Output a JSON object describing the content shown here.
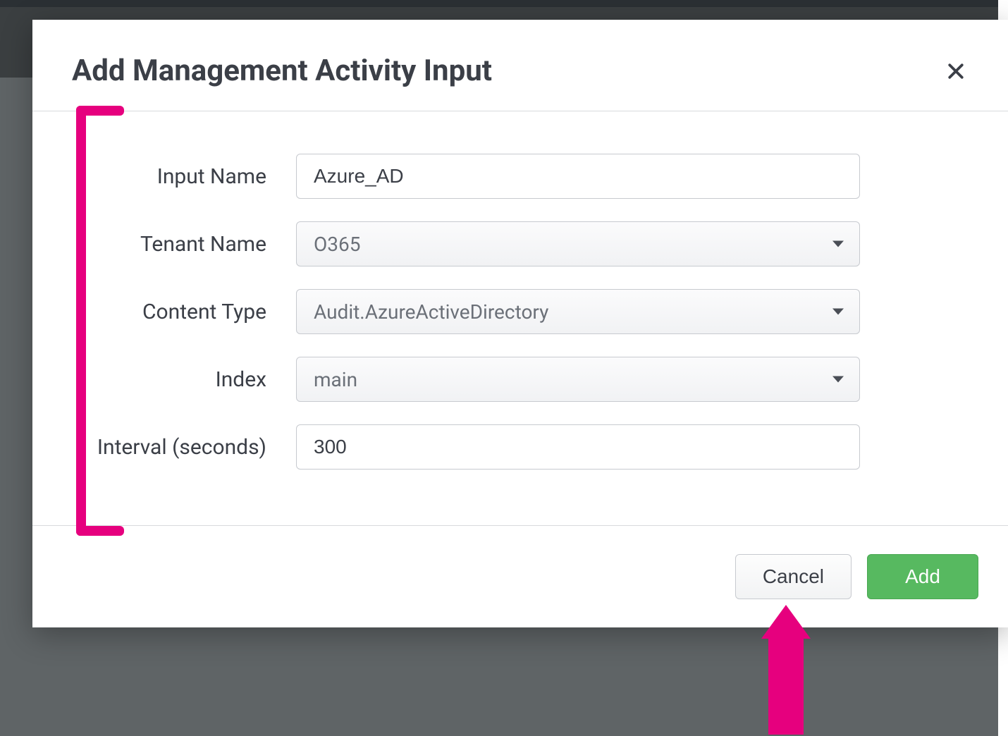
{
  "modal": {
    "title": "Add Management Activity Input",
    "fields": {
      "input_name": {
        "label": "Input Name",
        "value": "Azure_AD"
      },
      "tenant_name": {
        "label": "Tenant Name",
        "value": "O365"
      },
      "content_type": {
        "label": "Content Type",
        "value": "Audit.AzureActiveDirectory"
      },
      "index": {
        "label": "Index",
        "value": "main"
      },
      "interval": {
        "label": "Interval (seconds)",
        "value": "300"
      }
    },
    "buttons": {
      "cancel": "Cancel",
      "add": "Add"
    },
    "colors": {
      "primary": "#57b960",
      "annotation": "#e6007e"
    }
  }
}
